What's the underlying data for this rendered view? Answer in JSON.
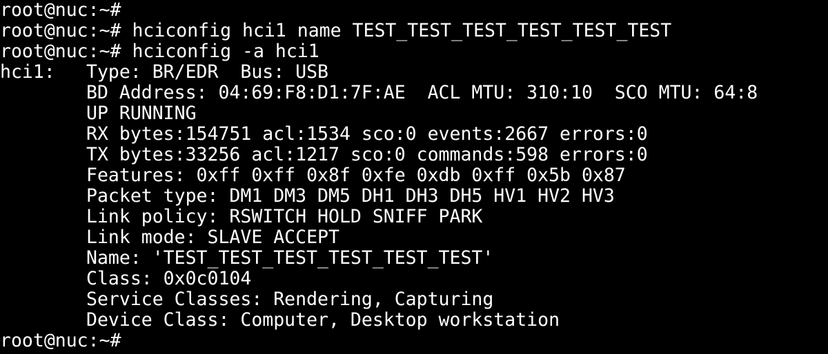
{
  "terminal": {
    "background": "#000000",
    "foreground": "#ffffff",
    "lines": [
      {
        "kind": "prompt",
        "text": "root@nuc:~#"
      },
      {
        "kind": "prompt",
        "text": "root@nuc:~# hciconfig hci1 name TEST_TEST_TEST_TEST_TEST_TEST"
      },
      {
        "kind": "prompt",
        "text": "root@nuc:~# hciconfig -a hci1"
      },
      {
        "kind": "output-head",
        "gutter": "hci1:",
        "text": "Type: BR/EDR  Bus: USB"
      },
      {
        "kind": "output",
        "text": "BD Address: 04:69:F8:D1:7F:AE  ACL MTU: 310:10  SCO MTU: 64:8"
      },
      {
        "kind": "output",
        "text": "UP RUNNING"
      },
      {
        "kind": "output",
        "text": "RX bytes:154751 acl:1534 sco:0 events:2667 errors:0"
      },
      {
        "kind": "output",
        "text": "TX bytes:33256 acl:1217 sco:0 commands:598 errors:0"
      },
      {
        "kind": "output",
        "text": "Features: 0xff 0xff 0x8f 0xfe 0xdb 0xff 0x5b 0x87"
      },
      {
        "kind": "output",
        "text": "Packet type: DM1 DM3 DM5 DH1 DH3 DH5 HV1 HV2 HV3"
      },
      {
        "kind": "output",
        "text": "Link policy: RSWITCH HOLD SNIFF PARK"
      },
      {
        "kind": "output",
        "text": "Link mode: SLAVE ACCEPT"
      },
      {
        "kind": "output",
        "text": "Name: 'TEST_TEST_TEST_TEST_TEST_TEST'"
      },
      {
        "kind": "output",
        "text": "Class: 0x0c0104"
      },
      {
        "kind": "output",
        "text": "Service Classes: Rendering, Capturing"
      },
      {
        "kind": "output",
        "text": "Device Class: Computer, Desktop workstation"
      },
      {
        "kind": "prompt",
        "text": "root@nuc:~#"
      }
    ]
  }
}
